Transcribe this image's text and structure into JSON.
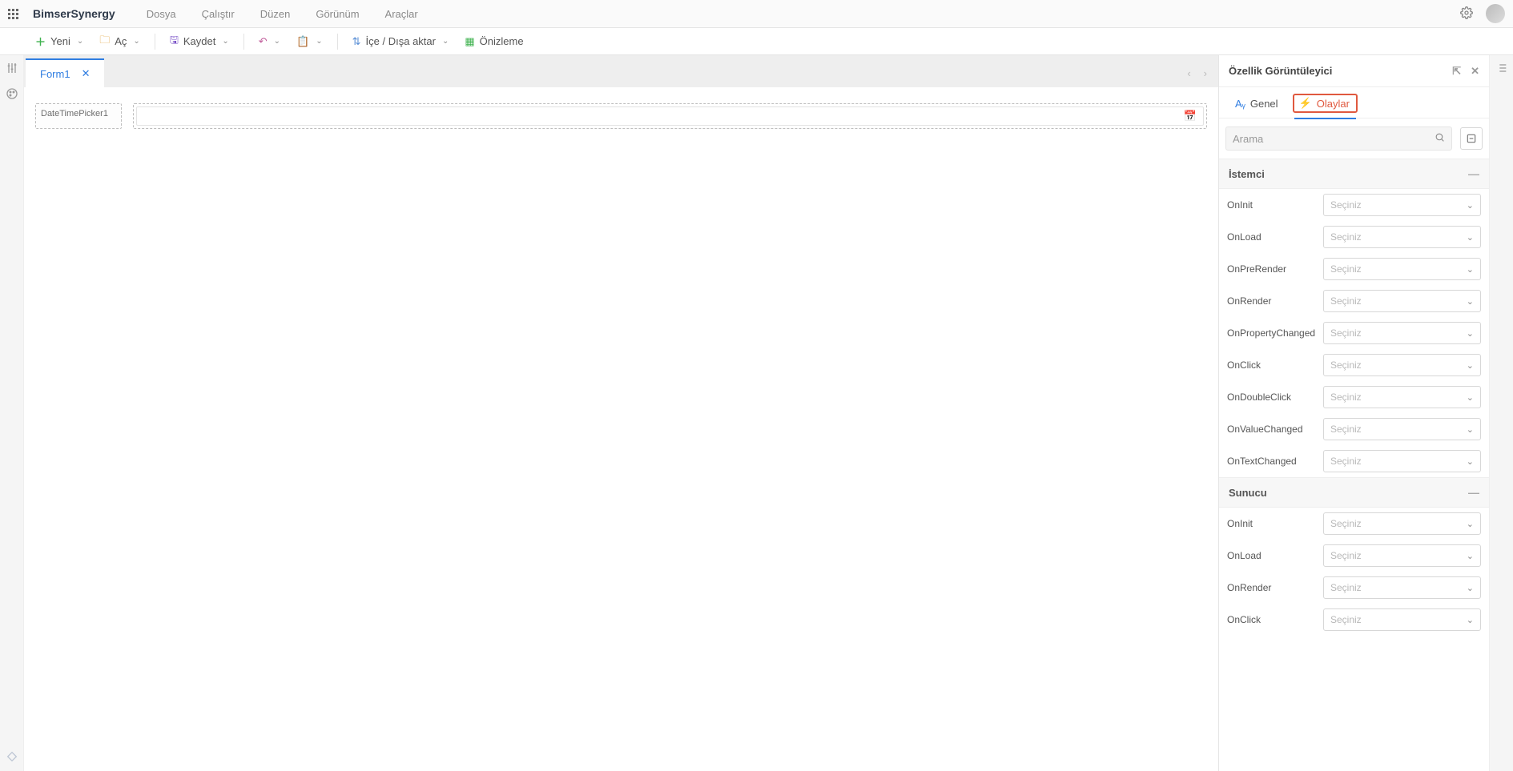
{
  "brand": "BimserSynergy",
  "topmenu": [
    "Dosya",
    "Çalıştır",
    "Düzen",
    "Görünüm",
    "Araçlar"
  ],
  "toolbar": {
    "new_label": "Yeni",
    "open_label": "Aç",
    "save_label": "Kaydet",
    "import_label": "İçe / Dışa aktar",
    "preview_label": "Önizleme"
  },
  "tabs": {
    "active": "Form1"
  },
  "canvas": {
    "control_label": "DateTimePicker1"
  },
  "panel": {
    "title": "Özellik Görüntüleyici",
    "tab_general": "Genel",
    "tab_events": "Olaylar",
    "search_placeholder": "Arama",
    "select_placeholder": "Seçiniz",
    "groups": {
      "client": "İstemci",
      "server": "Sunucu"
    },
    "client_events": [
      "OnInit",
      "OnLoad",
      "OnPreRender",
      "OnRender",
      "OnPropertyChanged",
      "OnClick",
      "OnDoubleClick",
      "OnValueChanged",
      "OnTextChanged"
    ],
    "server_events": [
      "OnInit",
      "OnLoad",
      "OnRender",
      "OnClick"
    ]
  }
}
